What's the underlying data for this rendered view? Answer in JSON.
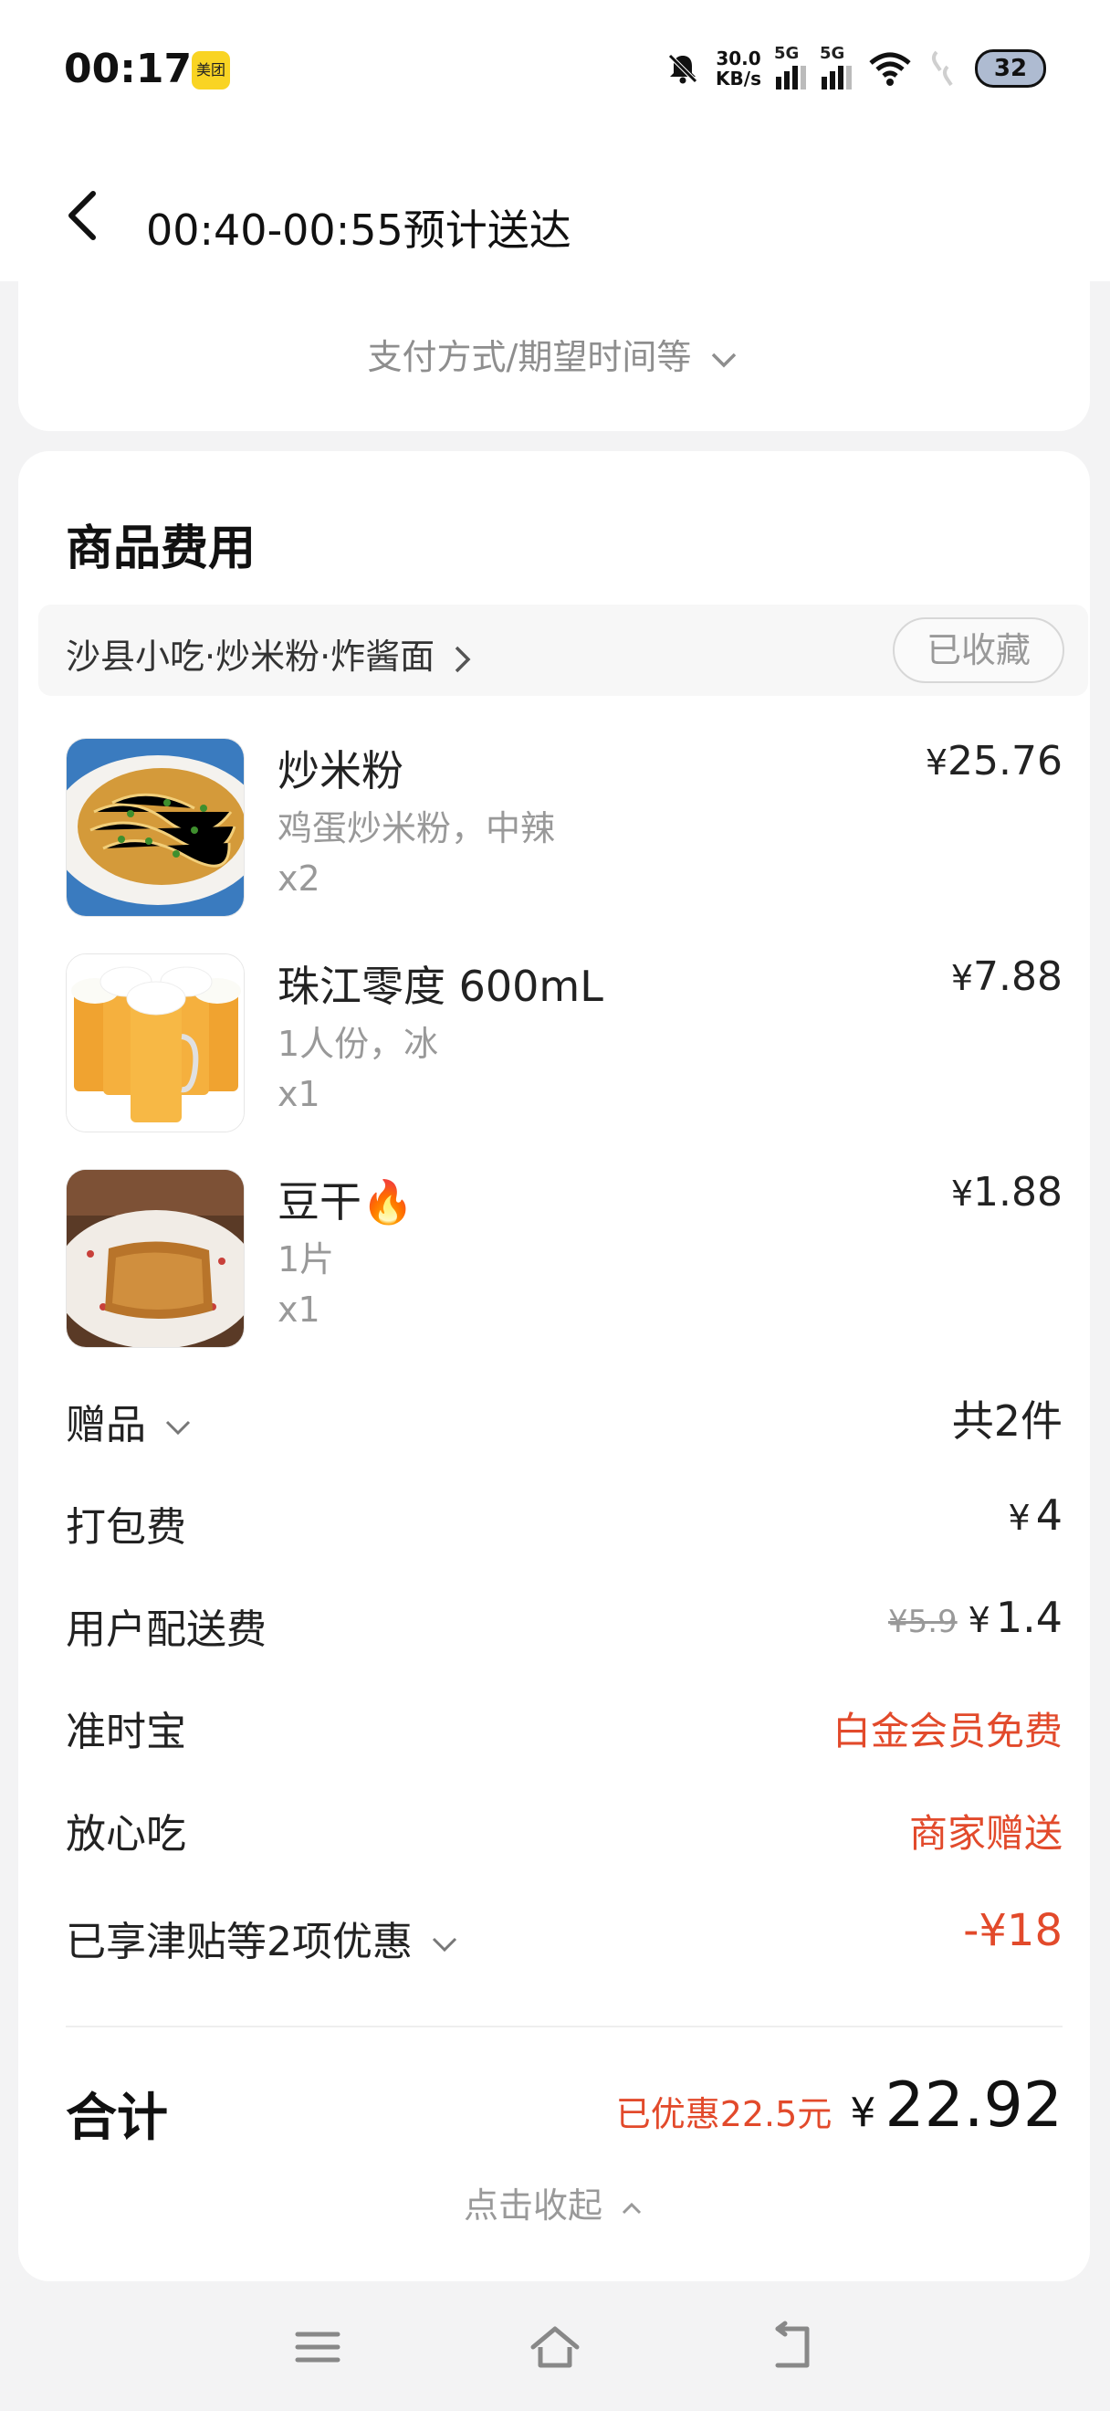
{
  "status_bar": {
    "time": "00:17",
    "app_badge": "美团",
    "speed_value": "30.0",
    "speed_unit": "KB/s",
    "sim1": "5G",
    "sim2": "5G",
    "battery": "32"
  },
  "header": {
    "title": "00:40-00:55预计送达"
  },
  "top_card": {
    "toggle_label": "支付方式/期望时间等"
  },
  "goods": {
    "section_title": "商品费用",
    "shop_name": "沙县小吃·炒米粉·炸酱面",
    "favorite_label": "已收藏",
    "items": [
      {
        "name": "炒米粉",
        "spec": "鸡蛋炒米粉，中辣",
        "qty": "x2",
        "currency": "¥",
        "price": "25.76",
        "icon": "fried-rice-noodles-image"
      },
      {
        "name": "珠江零度 600mL",
        "spec": "1人份，冰",
        "qty": "x1",
        "currency": "¥",
        "price": "7.88",
        "icon": "beer-mugs-image"
      },
      {
        "name": "豆干🔥",
        "spec": "1片",
        "qty": "x1",
        "currency": "¥",
        "price": "1.88",
        "icon": "tofu-image"
      }
    ]
  },
  "fees": {
    "gift": {
      "label": "赠品",
      "value": "共2件"
    },
    "packing": {
      "label": "打包费",
      "currency": "¥",
      "value": "4"
    },
    "delivery": {
      "label": "用户配送费",
      "original": "¥5.9",
      "currency": "¥",
      "value": "1.4"
    },
    "ontime": {
      "label": "准时宝",
      "value": "白金会员免费"
    },
    "assurance": {
      "label": "放心吃",
      "value": "商家赠送"
    },
    "discount": {
      "label": "已享津贴等2项优惠",
      "value": "-¥18"
    }
  },
  "total": {
    "label": "合计",
    "saved": "已优惠22.5元",
    "currency": "¥",
    "amount": "22.92",
    "collapse_label": "点击收起"
  },
  "colors": {
    "accent_red": "#e24a2b",
    "muted": "#999999",
    "background": "#f3f3f4"
  }
}
